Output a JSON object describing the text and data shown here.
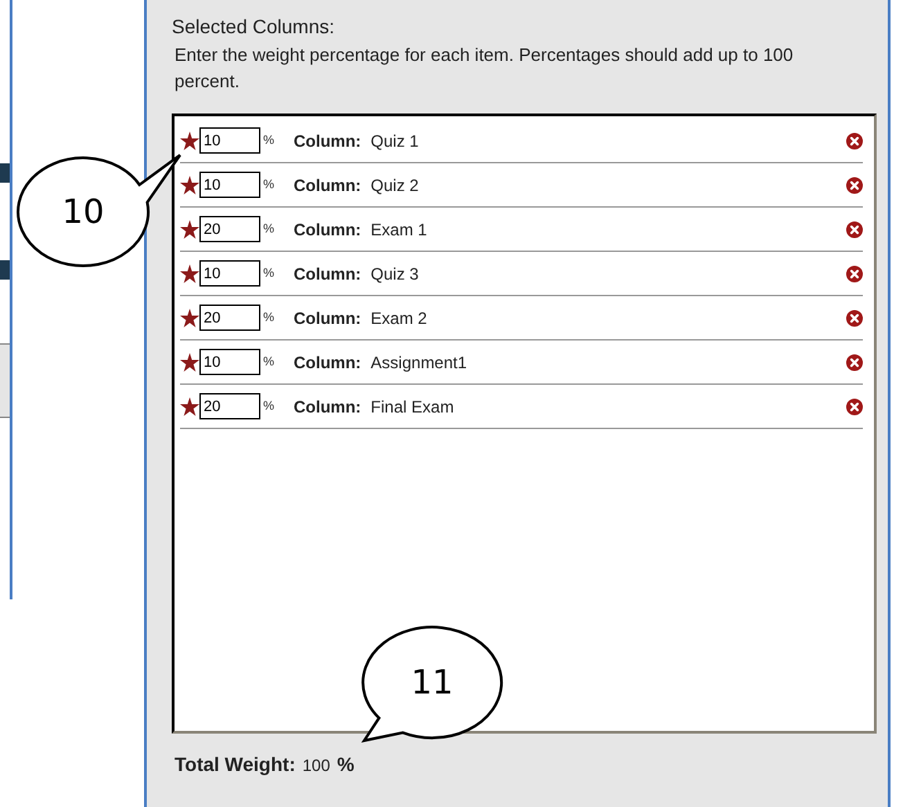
{
  "heading": "Selected Columns:",
  "instructions": "Enter the weight percentage for each item. Percentages should add up to 100 percent.",
  "items": [
    {
      "required": true,
      "value": "10",
      "unit": "%",
      "label": "Column:",
      "name": "Quiz 1"
    },
    {
      "required": true,
      "value": "10",
      "unit": "%",
      "label": "Column:",
      "name": "Quiz 2"
    },
    {
      "required": true,
      "value": "20",
      "unit": "%",
      "label": "Column:",
      "name": "Exam 1"
    },
    {
      "required": true,
      "value": "10",
      "unit": "%",
      "label": "Column:",
      "name": "Quiz 3"
    },
    {
      "required": true,
      "value": "20",
      "unit": "%",
      "label": "Column:",
      "name": "Exam 2"
    },
    {
      "required": true,
      "value": "10",
      "unit": "%",
      "label": "Column:",
      "name": "Assignment1"
    },
    {
      "required": true,
      "value": "20",
      "unit": "%",
      "label": "Column:",
      "name": "Final Exam"
    }
  ],
  "total": {
    "label": "Total Weight:",
    "value": "100",
    "unit": "%"
  },
  "callouts": [
    "10",
    "11"
  ]
}
